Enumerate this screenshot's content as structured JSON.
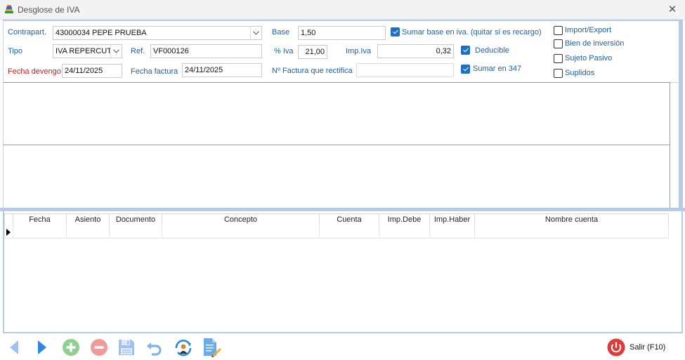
{
  "window": {
    "title": "Desglose de IVA",
    "close_glyph": "✕"
  },
  "form": {
    "contrapart_label": "Contrapart.",
    "contrapart_value": "43000034 PEPE PRUEBA",
    "tipo_label": "Tipo",
    "tipo_value": "IVA REPERCUTI",
    "ref_label": "Ref.",
    "ref_value": "VF000126",
    "fecha_devengo_label": "Fecha devengo",
    "fecha_devengo_value": "24/11/2025",
    "fecha_factura_label": "Fecha factura",
    "fecha_factura_value": "24/11/2025",
    "base_label": "Base",
    "base_value": "1,50",
    "pct_iva_label": "% Iva",
    "pct_iva_value": "21,00",
    "imp_iva_label": "Imp.Iva",
    "imp_iva_value": "0,32",
    "factura_rectifica_label": "Nº Factura que rectifica",
    "factura_rectifica_value": "",
    "sumar_base_label": "Sumar base en iva. (quitar si es recargo)",
    "sumar_base_checked": true,
    "deducible_label": "Deducible",
    "deducible_checked": true,
    "sumar_347_label": "Sumar en 347",
    "sumar_347_checked": true,
    "import_export_label": "Import/Export",
    "import_export_checked": false,
    "bien_inversion_label": "Bien de inversión",
    "bien_inversion_checked": false,
    "sujeto_pasivo_label": "Sujeto Pasivo",
    "sujeto_pasivo_checked": false,
    "suplidos_label": "Suplidos",
    "suplidos_checked": false
  },
  "grid": {
    "columns": [
      "Fecha",
      "Asiento",
      "Documento",
      "Concepto",
      "Cuenta",
      "Imp.Debe",
      "Imp.Haber",
      "Nombre cuenta"
    ],
    "rows": []
  },
  "toolbar": {
    "buttons": [
      {
        "name": "previous-button",
        "icon": "arrow-left-icon"
      },
      {
        "name": "next-button",
        "icon": "arrow-right-icon"
      },
      {
        "name": "add-button",
        "icon": "plus-icon"
      },
      {
        "name": "delete-button",
        "icon": "minus-icon"
      },
      {
        "name": "save-button",
        "icon": "floppy-icon"
      },
      {
        "name": "undo-button",
        "icon": "undo-icon"
      },
      {
        "name": "refresh-user-button",
        "icon": "user-refresh-icon"
      },
      {
        "name": "edit-document-button",
        "icon": "document-edit-icon"
      }
    ],
    "exit_label": "Salir  (F10)"
  },
  "colors": {
    "label_blue": "#1f5fa6",
    "label_red": "#d11a1a",
    "checkbox_blue": "#1f6fc4",
    "frame_blue": "#b8c9e4",
    "exit_red": "#e03b3b",
    "arrow_blue": "#2f86e0",
    "add_green": "#6cc36c",
    "delete_red": "#ef6a6a"
  }
}
